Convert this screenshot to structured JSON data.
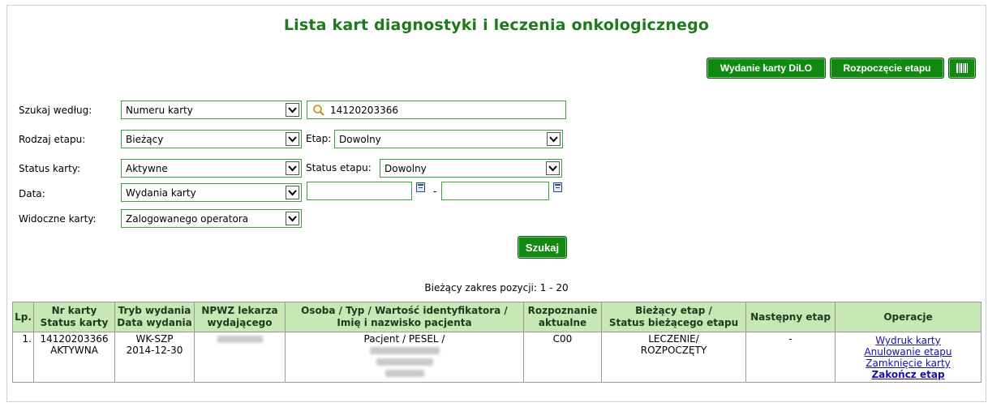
{
  "header": {
    "title": "Lista kart diagnostyki i leczenia onkologicznego"
  },
  "actions": {
    "issue_card": "Wydanie karty DiLO",
    "start_stage": "Rozpoczęcie etapu",
    "barcode_icon": "barcode-icon"
  },
  "form": {
    "search_by": {
      "label": "Szukaj według:",
      "value": "Numeru karty",
      "query": "14120203366"
    },
    "stage_kind": {
      "label": "Rodzaj etapu:",
      "value": "Bieżący"
    },
    "stage": {
      "label": "Etap:",
      "value": "Dowolny"
    },
    "card_status": {
      "label": "Status karty:",
      "value": "Aktywne"
    },
    "stage_status": {
      "label": "Status etapu:",
      "value": "Dowolny"
    },
    "date": {
      "label": "Data:",
      "value": "Wydania karty",
      "from": "",
      "separator": "-",
      "to": ""
    },
    "visible_cards": {
      "label": "Widoczne karty:",
      "value": "Zalogowanego operatora"
    },
    "search_button": "Szukaj"
  },
  "results": {
    "range_text": "Bieżący zakres pozycji: 1 - 20",
    "columns": [
      {
        "l1": "Lp.",
        "l2": ""
      },
      {
        "l1": "Nr karty",
        "l2": "Status karty"
      },
      {
        "l1": "Tryb wydania",
        "l2": "Data wydania"
      },
      {
        "l1": "NPWZ lekarza",
        "l2": "wydającego"
      },
      {
        "l1": "Osoba / Typ / Wartość identyfikatora /",
        "l2": "Imię i nazwisko pacjenta"
      },
      {
        "l1": "Rozpoznanie",
        "l2": "aktualne"
      },
      {
        "l1": "Bieżący etap /",
        "l2": "Status bieżącego etapu"
      },
      {
        "l1": "Następny etap",
        "l2": ""
      },
      {
        "l1": "Operacje",
        "l2": ""
      }
    ],
    "rows": [
      {
        "lp": "1.",
        "card_no": "14120203366",
        "card_status": "AKTYWNA",
        "mode": "WK-SZP",
        "date": "2014-12-30",
        "patient_type": "Pacjent / PESEL /",
        "diagnosis": "C00",
        "stage": "LECZENIE/",
        "stage_status": "ROZPOCZĘTY",
        "next_stage": "-",
        "ops": [
          "Wydruk karty",
          "Anulowanie etapu",
          "Zamknięcie karty",
          "Zakończ etap"
        ]
      }
    ]
  },
  "colors": {
    "accent": "#128a12",
    "title": "#1c7a1c",
    "header_bg": "#c7e8b5",
    "field_border": "#3aa23a"
  }
}
